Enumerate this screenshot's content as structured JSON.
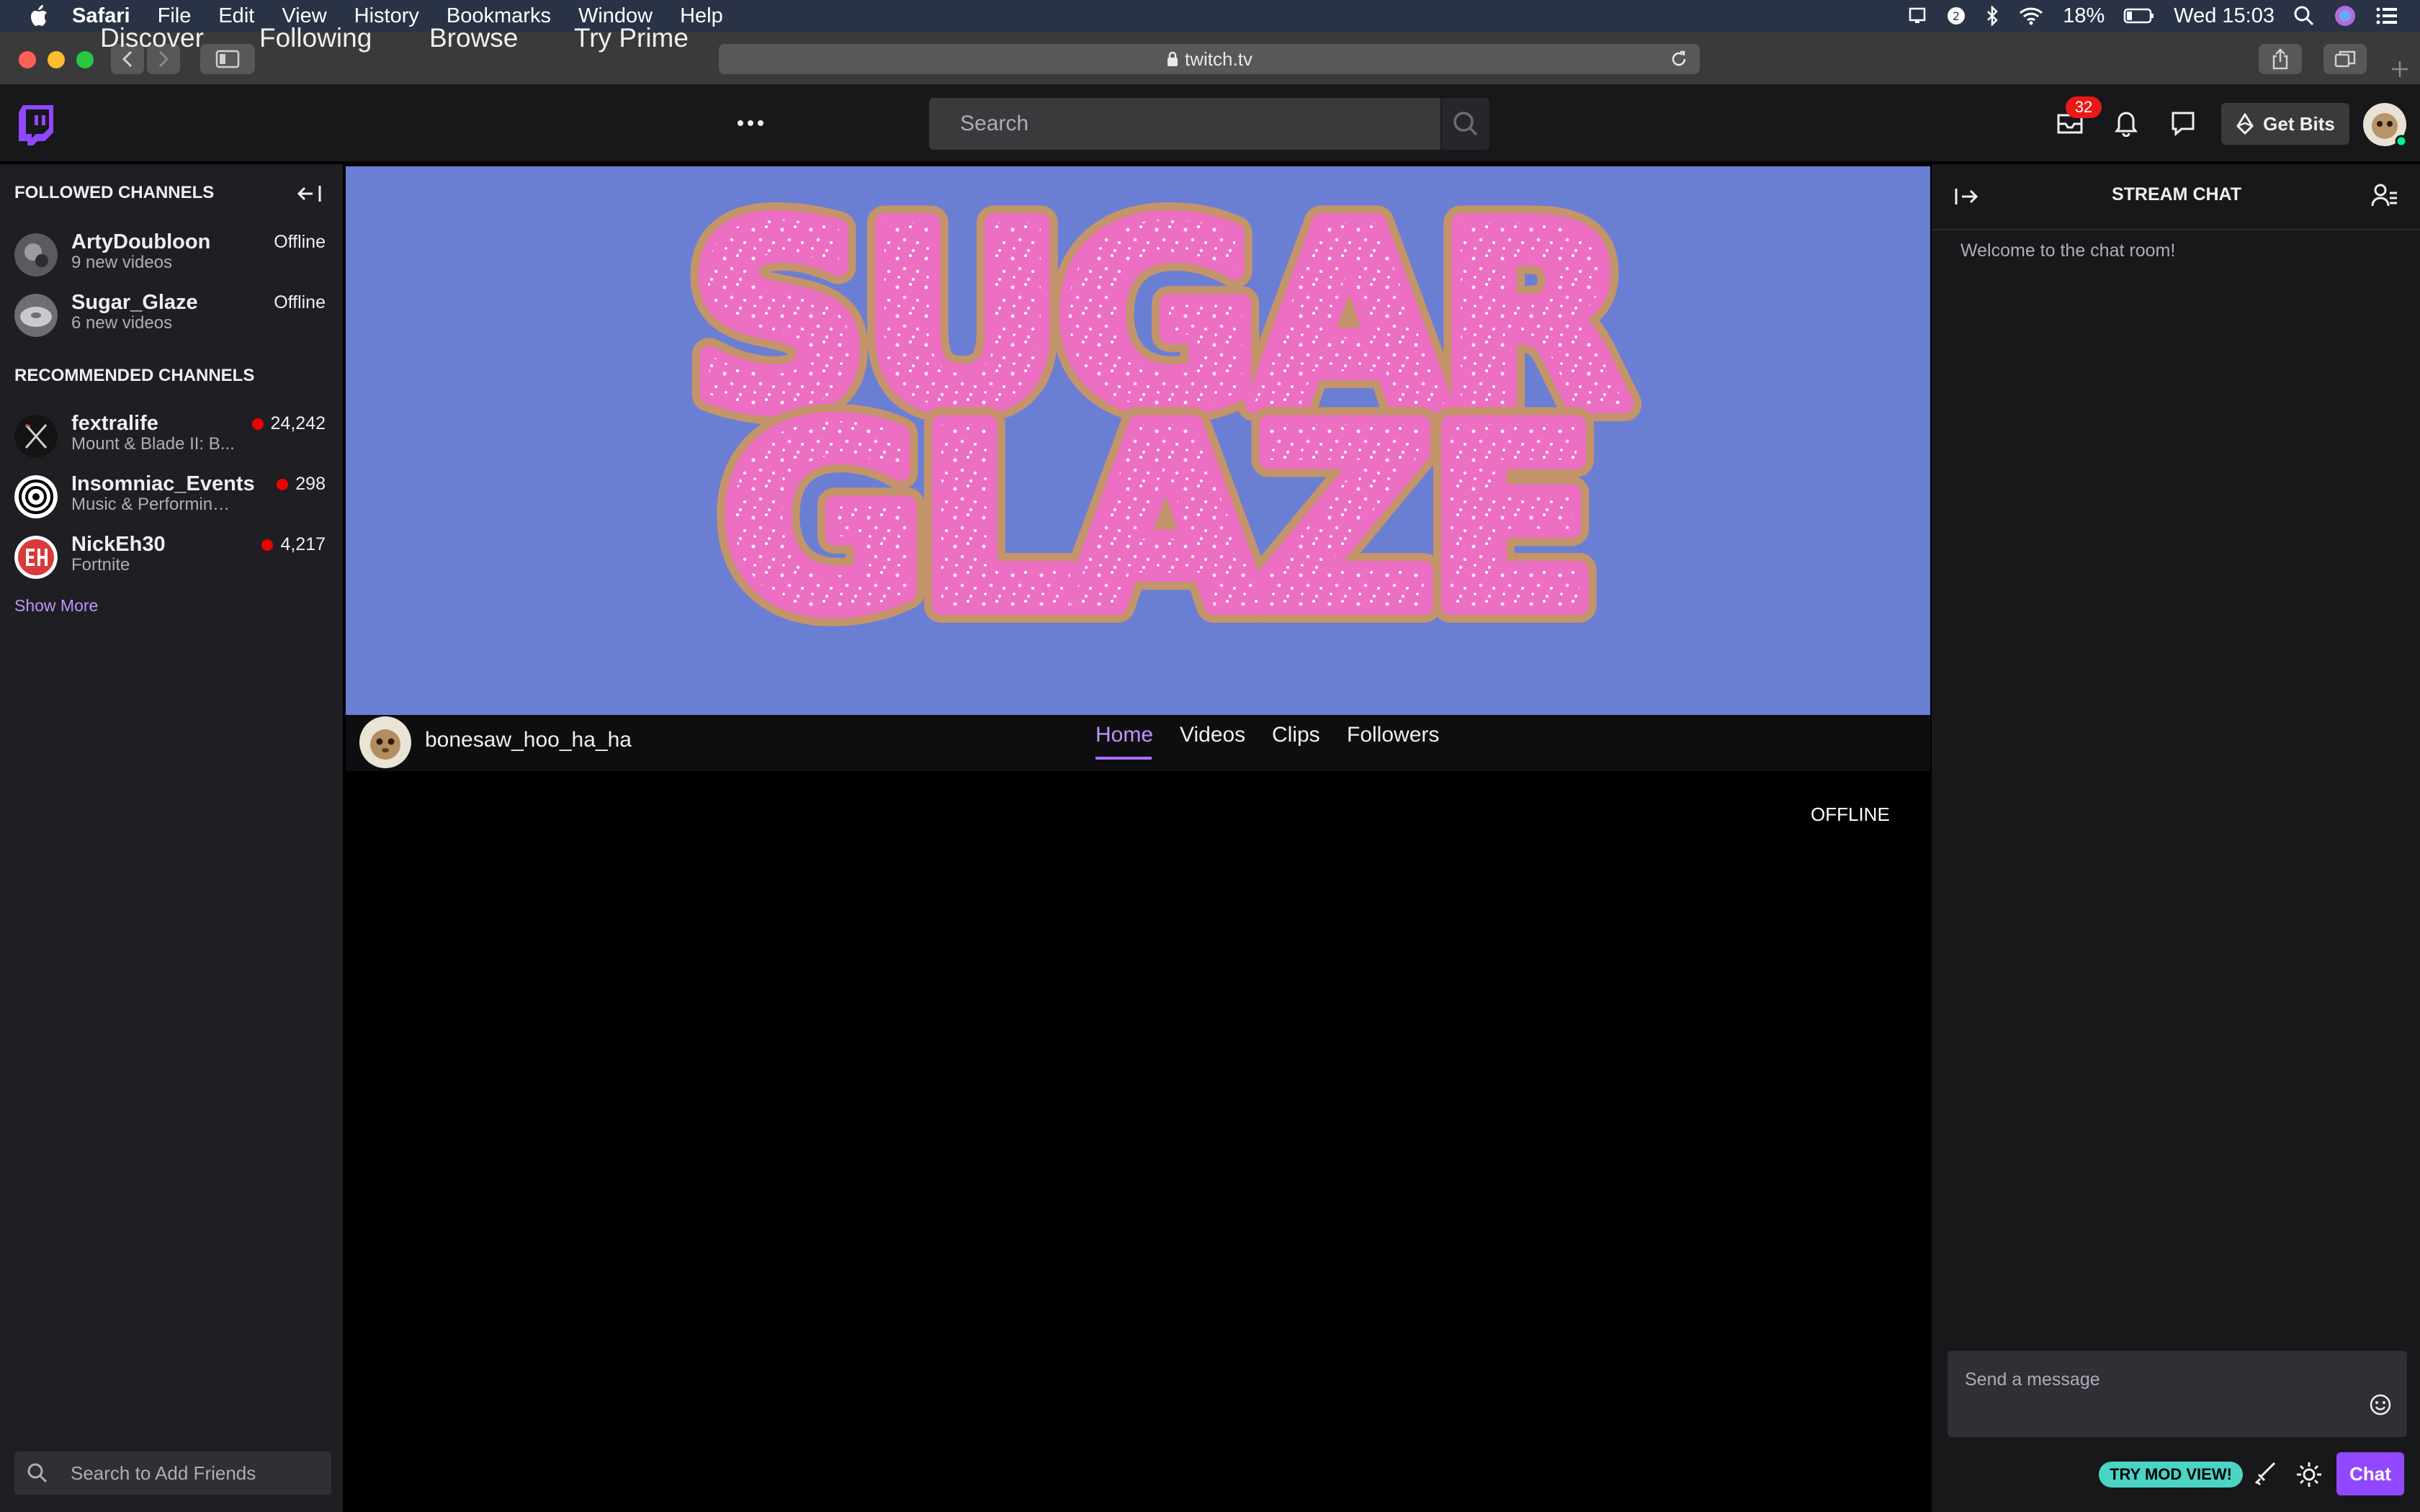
{
  "menubar": {
    "app": "Safari",
    "items": [
      "File",
      "Edit",
      "View",
      "History",
      "Bookmarks",
      "Window",
      "Help"
    ],
    "battery": "18%",
    "clock": "Wed 15:03"
  },
  "browser": {
    "url": "twitch.tv"
  },
  "nav": {
    "links": [
      "Discover",
      "Following",
      "Browse",
      "Try Prime"
    ],
    "search_placeholder": "Search",
    "notifications_count": "32",
    "get_bits": "Get Bits"
  },
  "sidebar": {
    "followed_heading": "FOLLOWED CHANNELS",
    "followed": [
      {
        "name": "ArtyDoubloon",
        "sub": "9 new videos",
        "status": "Offline"
      },
      {
        "name": "Sugar_Glaze",
        "sub": "6 new videos",
        "status": "Offline"
      }
    ],
    "recommended_heading": "RECOMMENDED CHANNELS",
    "recommended": [
      {
        "name": "fextralife",
        "sub": "Mount & Blade II: B...",
        "viewers": "24,242"
      },
      {
        "name": "Insomniac_Events",
        "sub": "Music & Performing Art...",
        "viewers": "298"
      },
      {
        "name": "NickEh30",
        "sub": "Fortnite",
        "viewers": "4,217"
      }
    ],
    "show_more": "Show More",
    "friends_placeholder": "Search to Add Friends"
  },
  "banner": {
    "line1": "SUGAR",
    "line2": "GLAZE"
  },
  "channel": {
    "name": "bonesaw_hoo_ha_ha",
    "tabs": [
      "Home",
      "Videos",
      "Clips",
      "Followers"
    ],
    "active_tab": "Home",
    "player_status": "OFFLINE"
  },
  "chat": {
    "title": "STREAM CHAT",
    "welcome": "Welcome to the chat room!",
    "input_placeholder": "Send a message",
    "mod_view": "TRY MOD VIEW!",
    "chat_button": "Chat"
  },
  "colors": {
    "accent": "#9147ff",
    "banner_bg": "#6a7fd3",
    "donut_pink": "#ec6fc4",
    "live_red": "#eb0400"
  }
}
